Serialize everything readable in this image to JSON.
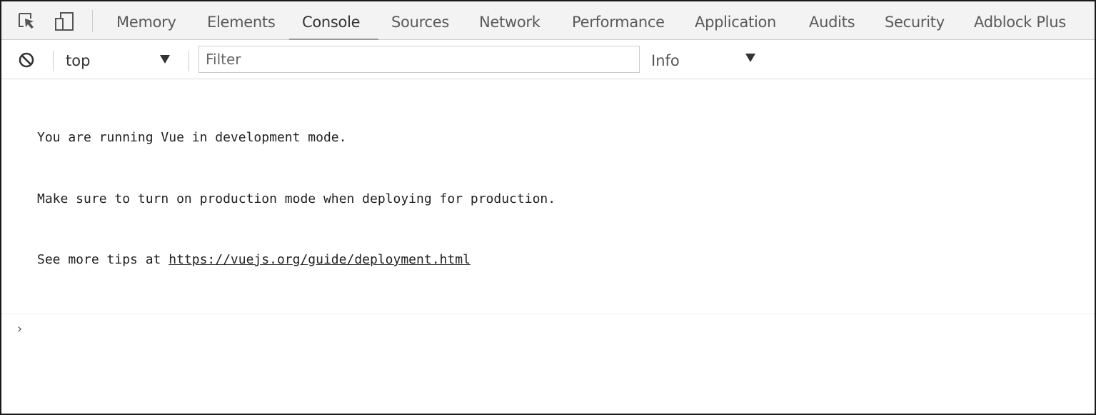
{
  "tabs": [
    {
      "label": "Memory",
      "active": false
    },
    {
      "label": "Elements",
      "active": false
    },
    {
      "label": "Console",
      "active": true
    },
    {
      "label": "Sources",
      "active": false
    },
    {
      "label": "Network",
      "active": false
    },
    {
      "label": "Performance",
      "active": false
    },
    {
      "label": "Application",
      "active": false
    },
    {
      "label": "Audits",
      "active": false
    },
    {
      "label": "Security",
      "active": false
    },
    {
      "label": "Adblock Plus",
      "active": false
    }
  ],
  "toolbar": {
    "context": "top",
    "filter_placeholder": "Filter",
    "filter_value": "",
    "level": "Info"
  },
  "console": {
    "messages": [
      {
        "lines": [
          "You are running Vue in development mode.",
          "Make sure to turn on production mode when deploying for production."
        ],
        "link_prefix": "See more tips at ",
        "link_text": "https://vuejs.org/guide/deployment.html"
      }
    ],
    "prompt_symbol": "›"
  },
  "colors": {
    "tabbar_bg": "#f3f3f3",
    "active_underline": "#999999",
    "text": "#333333"
  },
  "icons": {
    "inspect": "inspect-element-icon",
    "device": "device-toolbar-icon",
    "clear": "clear-console-icon"
  }
}
